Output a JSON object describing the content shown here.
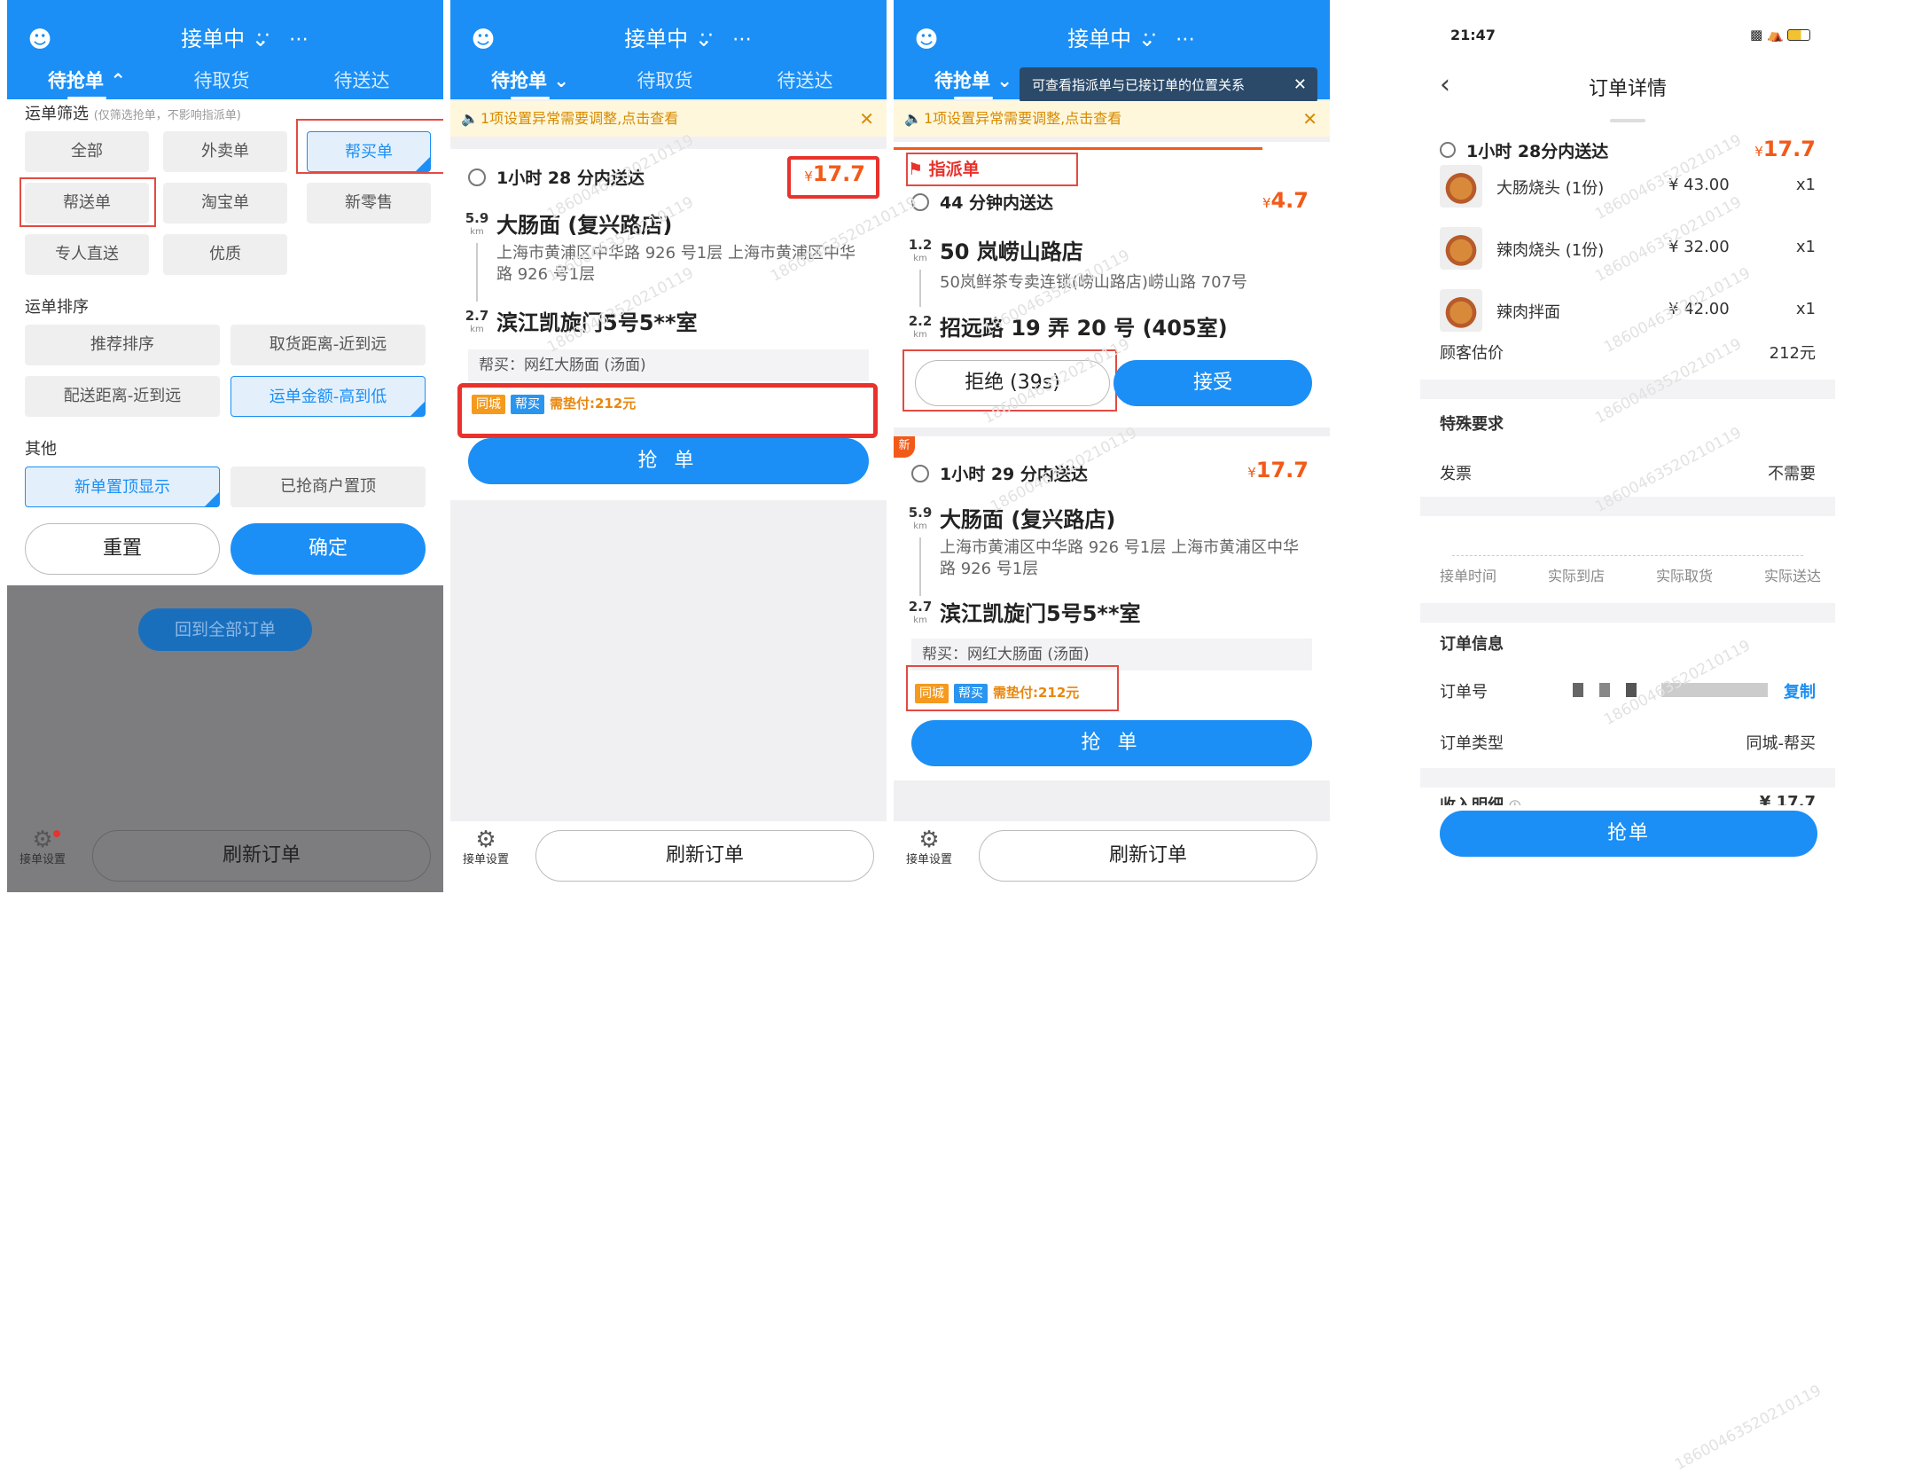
{
  "common": {
    "status_title": "接单中",
    "tabs": [
      "待抢单",
      "待取货",
      "待送达"
    ],
    "notice": "1项设置异常需要调整,点击查看",
    "refresh": "刷新订单",
    "settings": "接单设置",
    "grab": "抢 单",
    "currency": "¥"
  },
  "panel1": {
    "filter_title": "运单筛选",
    "filter_hint": "(仅筛选抢单，不影响指派单)",
    "filters": [
      "全部",
      "外卖单",
      "帮买单",
      "帮送单",
      "淘宝单",
      "新零售",
      "专人直送",
      "优质"
    ],
    "sort_title": "运单排序",
    "sorts": [
      "推荐排序",
      "取货距离-近到远",
      "配送距离-近到远",
      "运单金额-高到低"
    ],
    "other_title": "其他",
    "others": [
      "新单置顶显示",
      "已抢商户置顶"
    ],
    "reset": "重置",
    "confirm": "确定",
    "back_all": "回到全部订单"
  },
  "panel2": {
    "deliver_time": "1小时 28 分内送达",
    "price": "17.7",
    "pickup_dist": "5.9",
    "pickup_name": "大肠面 (复兴路店)",
    "pickup_addr": "上海市黄浦区中华路 926 号1层 上海市黄浦区中华路 926 号1层",
    "drop_dist": "2.7",
    "drop_name": "滨江凯旋门5号5**室",
    "buy_note": "帮买：网红大肠面 (汤面)",
    "tag1": "同城",
    "tag2": "帮买",
    "need_pay": "需垫付:212元",
    "km": "km"
  },
  "panel3": {
    "tooltip": "可查看指派单与已接订单的位置关系",
    "assign_label": "指派单",
    "a_time": "44 分钟内送达",
    "a_price": "4.7",
    "a_pickup_dist": "1.2",
    "a_pickup_name": "50 岚崂山路店",
    "a_pickup_addr": "50岚鲜茶专卖连锁(崂山路店)崂山路 707号",
    "a_drop_dist": "2.2",
    "a_drop_name": "招远路 19 弄 20 号 (405室)",
    "reject": "拒绝 (39s)",
    "accept": "接受",
    "new_badge": "新",
    "b_time": "1小时 29 分内送达",
    "b_price": "17.7",
    "b_pickup_dist": "5.9",
    "b_pickup_name": "大肠面 (复兴路店)",
    "b_pickup_addr": "上海市黄浦区中华路 926 号1层 上海市黄浦区中华路 926 号1层",
    "b_drop_dist": "2.7",
    "b_drop_name": "滨江凯旋门5号5**室",
    "b_buy_note": "帮买：网红大肠面 (汤面)",
    "tag1": "同城",
    "tag2": "帮买",
    "need_pay": "需垫付:212元"
  },
  "panel4": {
    "clock": "21:47",
    "title": "订单详情",
    "time": "1小时 28分内送达",
    "price": "17.7",
    "items": [
      {
        "name": "大肠烧头 (1份)",
        "price": "¥ 43.00",
        "qty": "x1"
      },
      {
        "name": "辣肉烧头 (1份)",
        "price": "¥ 32.00",
        "qty": "x1"
      },
      {
        "name": "辣肉拌面",
        "price": "¥ 42.00",
        "qty": "x1"
      }
    ],
    "estimate_label": "顾客估价",
    "estimate": "212元",
    "special_title": "特殊要求",
    "invoice_label": "发票",
    "invoice": "不需要",
    "timeline": [
      "接单时间",
      "实际到店",
      "实际取货",
      "实际送达"
    ],
    "info_title": "订单信息",
    "order_no_label": "订单号",
    "copy": "复制",
    "order_type_label": "订单类型",
    "order_type": "同城-帮买",
    "income_label": "收入明细",
    "income": "¥ 17.7",
    "grab": "抢单"
  },
  "watermark": "18600463520210119",
  "colors": {
    "primary": "#1b8ff5",
    "price": "#f25a19",
    "warn": "#e8322c"
  }
}
